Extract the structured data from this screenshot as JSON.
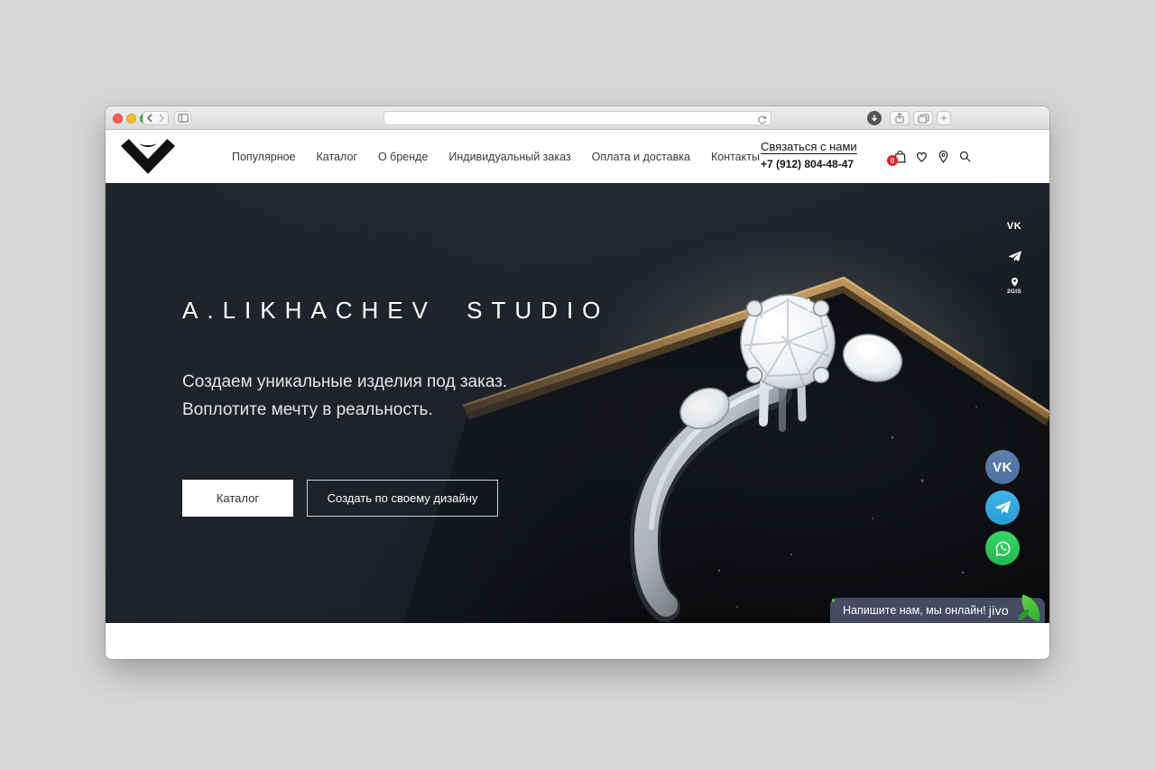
{
  "browser": {
    "url_value": "",
    "new_tab_label": "+"
  },
  "header": {
    "nav": [
      "Популярное",
      "Каталог",
      "О бренде",
      "Индивидуальный заказ",
      "Оплата и доставка",
      "Контакты"
    ],
    "contact_link": "Связаться с нами",
    "phone": "+7 (912) 804-48-47",
    "cart_count": "0"
  },
  "hero": {
    "title": "A.LIKHACHEV STUDIO",
    "subtitle_line1": "Создаем уникальные изделия под заказ.",
    "subtitle_line2": "Воплотите мечту в реальность.",
    "catalog_button": "Каталог",
    "custom_design_button": "Создать по своему дизайну"
  },
  "icons": {
    "vk_text": "VK",
    "gis_label": "2GIS"
  },
  "chat": {
    "message": "Напишите нам, мы онлайн!",
    "brand": "jivo"
  },
  "colors": {
    "badge_red": "#e31e24",
    "vk_blue": "#4d6f9e",
    "telegram_blue": "#2f9fd8",
    "whatsapp_green": "#25c353",
    "jivo_green": "#48c63e",
    "gold": "#b08c52",
    "chat_bg": "#454b63"
  }
}
